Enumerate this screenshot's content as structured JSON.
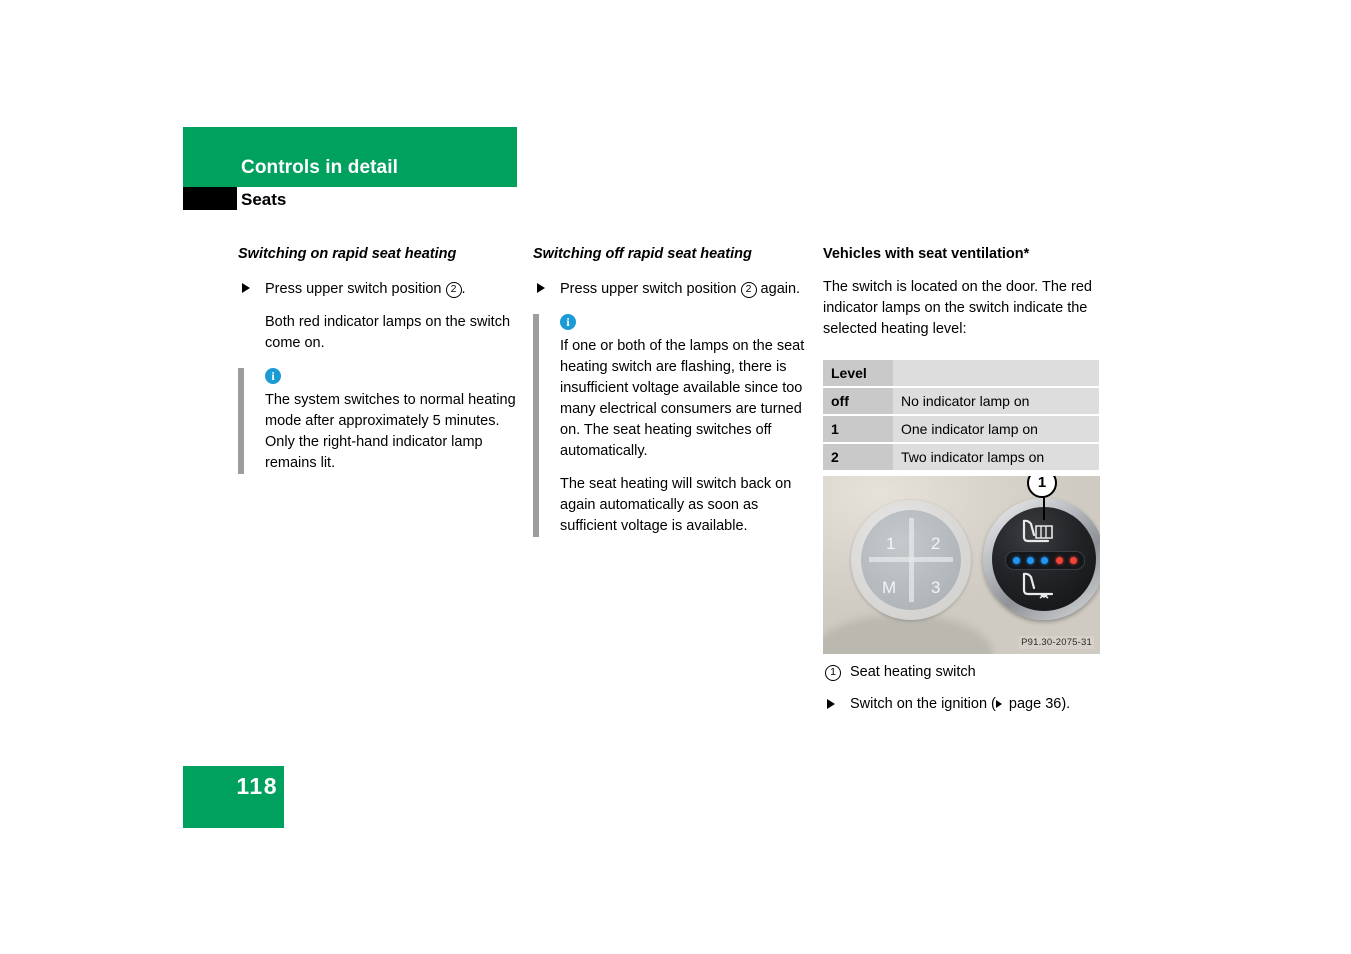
{
  "header": {
    "chapter_title": "Controls in detail",
    "section_title": "Seats",
    "band_color": "#00a05e"
  },
  "columns": {
    "col1": {
      "heading": "Switching on rapid seat heating",
      "step_pre": "Press upper switch position ",
      "step_circled": "2",
      "step_post": ".",
      "result": "Both red indicator lamps on the switch come on.",
      "note": {
        "icon": "info-icon",
        "paragraphs": [
          "The system switches to normal heating mode after approximately 5 minutes. Only the right-hand indicator lamp remains lit."
        ]
      }
    },
    "col2": {
      "heading": "Switching off rapid seat heating",
      "step_pre": "Press upper switch position ",
      "step_circled": "2",
      "step_post": " again.",
      "note": {
        "icon": "info-icon",
        "paragraphs": [
          "If one or both of the lamps on the seat heating switch are flashing, there is insufficient voltage available since too many electrical consumers are turned on. The seat heating switches off automatically.",
          "The seat heating will switch back on again automatically as soon as sufficient voltage is available."
        ]
      }
    },
    "col3": {
      "heading": "Vehicles with seat ventilation*",
      "intro": "The switch is located on the door. The red indicator lamps on the switch indicate the selected heating level:",
      "table": {
        "header": [
          "Level",
          ""
        ],
        "rows": [
          [
            "off",
            "No indicator lamp on"
          ],
          [
            "1",
            "One indicator lamp on"
          ],
          [
            "2",
            "Two indicator lamps on"
          ]
        ]
      }
    }
  },
  "figure": {
    "callout_number": "1",
    "memory_labels": [
      "1",
      "2",
      "M",
      "3"
    ],
    "leds": [
      "blue",
      "blue",
      "blue",
      "red",
      "red"
    ],
    "image_code": "P91.30-2075-31",
    "caption_number": "1",
    "caption_label": "Seat heating switch",
    "action_pre": "Switch on the ignition (",
    "action_post": " page 36)."
  },
  "footer": {
    "page_number": "118"
  }
}
